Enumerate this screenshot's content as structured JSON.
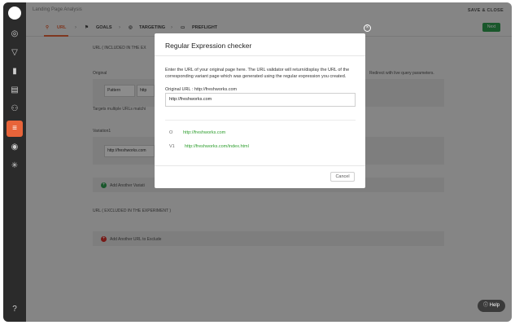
{
  "header": {
    "title": "Landing Page Analysis",
    "save_close": "SAVE & CLOSE",
    "next": "Next"
  },
  "steps": [
    {
      "label": "URL"
    },
    {
      "label": "GOALS"
    },
    {
      "label": "TARGETING"
    },
    {
      "label": "PREFLIGHT"
    }
  ],
  "background": {
    "included_section": "URL ( INCLUDED IN THE EX",
    "original_label": "Original",
    "pattern_select": "Pattern",
    "pattern_input": "http",
    "target_hint": "Targets multiple URLs matchi",
    "redirect_hint": "Redirect with live query parameters.",
    "variation_label": "Variation1",
    "variation_input": "http://freshworks.com",
    "add_variation": "Add Another Variati",
    "excluded_section": "URL ( EXCLUDED IN THE EXPERIMENT )",
    "add_exclude": "Add Another URL to Exclude"
  },
  "modal": {
    "title": "Regular Expression checker",
    "description": "Enter the URL of your original page here. The URL validator will return/display the URL of the corresponding variant page which was generated using the regular expression you created.",
    "original_url_label": "Original URL : http://freshworks.com",
    "original_url_value": "http://freshworks.com",
    "results": [
      {
        "key": "O",
        "url": "http://freshworks.com"
      },
      {
        "key": "V1",
        "url": "http://freshworks.com/index.html"
      }
    ],
    "cancel": "Cancel"
  },
  "help": "Help",
  "colors": {
    "accent": "#e8643a",
    "success": "#2e9e4f",
    "sidebar": "#2b2b2b",
    "link_green": "#2e9e2e"
  }
}
